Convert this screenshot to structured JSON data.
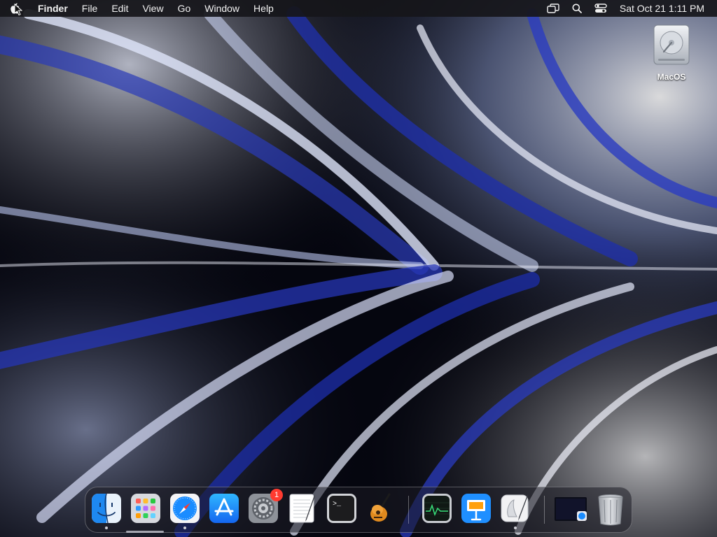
{
  "menubar": {
    "app_name": "Finder",
    "items": [
      "File",
      "Edit",
      "View",
      "Go",
      "Window",
      "Help"
    ],
    "clock": "Sat Oct 21  1:11 PM",
    "status_icons": [
      "screen-mirroring-icon",
      "spotlight-search-icon",
      "control-center-icon"
    ]
  },
  "desktop": {
    "drive_label": "MacOS",
    "wallpaper_colors": [
      "#05060f",
      "#1a2a8c",
      "#cfd8f2",
      "#ffffff"
    ]
  },
  "dock": {
    "apps": [
      {
        "name": "Finder",
        "icon": "finder-icon",
        "running": true
      },
      {
        "name": "Launchpad",
        "icon": "launchpad-icon",
        "running": false
      },
      {
        "name": "Safari",
        "icon": "safari-icon",
        "running": true
      },
      {
        "name": "App Store",
        "icon": "app-store-icon",
        "running": false
      },
      {
        "name": "System Settings",
        "icon": "system-settings-icon",
        "running": false,
        "badge": "1"
      },
      {
        "name": "TextEdit",
        "icon": "textedit-icon",
        "running": false
      },
      {
        "name": "Terminal",
        "icon": "terminal-icon",
        "running": false
      },
      {
        "name": "GarageBand",
        "icon": "garageband-icon",
        "running": false
      },
      {
        "name": "Activity Monitor",
        "icon": "activity-monitor-icon",
        "running": false
      },
      {
        "name": "Keynote",
        "icon": "keynote-icon",
        "running": false
      },
      {
        "name": "Script Editor",
        "icon": "script-editor-icon",
        "running": true
      },
      {
        "name": "Downloads",
        "icon": "downloads-stack-icon",
        "running": false
      },
      {
        "name": "Trash",
        "icon": "trash-icon",
        "running": false
      }
    ]
  }
}
